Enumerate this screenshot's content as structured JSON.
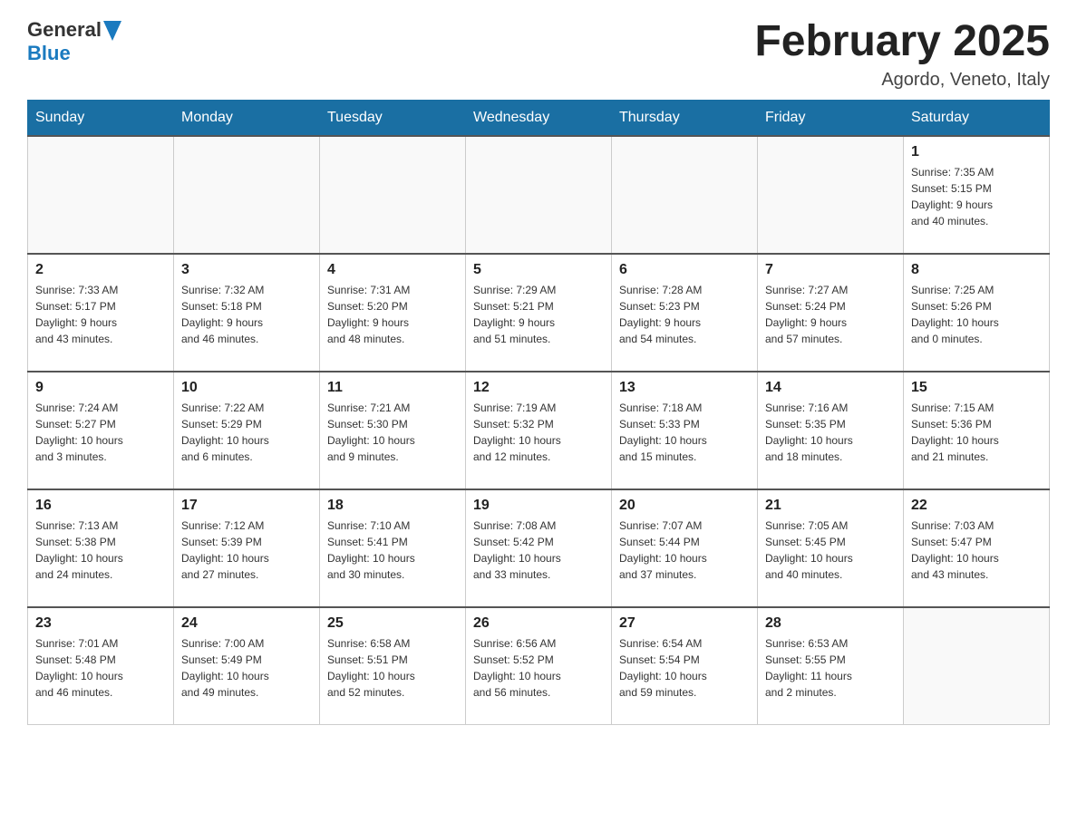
{
  "header": {
    "logo": {
      "general": "General",
      "arrow": "▶",
      "blue": "Blue"
    },
    "title": "February 2025",
    "location": "Agordo, Veneto, Italy"
  },
  "weekdays": [
    "Sunday",
    "Monday",
    "Tuesday",
    "Wednesday",
    "Thursday",
    "Friday",
    "Saturday"
  ],
  "weeks": [
    {
      "days": [
        {
          "number": "",
          "info": ""
        },
        {
          "number": "",
          "info": ""
        },
        {
          "number": "",
          "info": ""
        },
        {
          "number": "",
          "info": ""
        },
        {
          "number": "",
          "info": ""
        },
        {
          "number": "",
          "info": ""
        },
        {
          "number": "1",
          "info": "Sunrise: 7:35 AM\nSunset: 5:15 PM\nDaylight: 9 hours\nand 40 minutes."
        }
      ]
    },
    {
      "days": [
        {
          "number": "2",
          "info": "Sunrise: 7:33 AM\nSunset: 5:17 PM\nDaylight: 9 hours\nand 43 minutes."
        },
        {
          "number": "3",
          "info": "Sunrise: 7:32 AM\nSunset: 5:18 PM\nDaylight: 9 hours\nand 46 minutes."
        },
        {
          "number": "4",
          "info": "Sunrise: 7:31 AM\nSunset: 5:20 PM\nDaylight: 9 hours\nand 48 minutes."
        },
        {
          "number": "5",
          "info": "Sunrise: 7:29 AM\nSunset: 5:21 PM\nDaylight: 9 hours\nand 51 minutes."
        },
        {
          "number": "6",
          "info": "Sunrise: 7:28 AM\nSunset: 5:23 PM\nDaylight: 9 hours\nand 54 minutes."
        },
        {
          "number": "7",
          "info": "Sunrise: 7:27 AM\nSunset: 5:24 PM\nDaylight: 9 hours\nand 57 minutes."
        },
        {
          "number": "8",
          "info": "Sunrise: 7:25 AM\nSunset: 5:26 PM\nDaylight: 10 hours\nand 0 minutes."
        }
      ]
    },
    {
      "days": [
        {
          "number": "9",
          "info": "Sunrise: 7:24 AM\nSunset: 5:27 PM\nDaylight: 10 hours\nand 3 minutes."
        },
        {
          "number": "10",
          "info": "Sunrise: 7:22 AM\nSunset: 5:29 PM\nDaylight: 10 hours\nand 6 minutes."
        },
        {
          "number": "11",
          "info": "Sunrise: 7:21 AM\nSunset: 5:30 PM\nDaylight: 10 hours\nand 9 minutes."
        },
        {
          "number": "12",
          "info": "Sunrise: 7:19 AM\nSunset: 5:32 PM\nDaylight: 10 hours\nand 12 minutes."
        },
        {
          "number": "13",
          "info": "Sunrise: 7:18 AM\nSunset: 5:33 PM\nDaylight: 10 hours\nand 15 minutes."
        },
        {
          "number": "14",
          "info": "Sunrise: 7:16 AM\nSunset: 5:35 PM\nDaylight: 10 hours\nand 18 minutes."
        },
        {
          "number": "15",
          "info": "Sunrise: 7:15 AM\nSunset: 5:36 PM\nDaylight: 10 hours\nand 21 minutes."
        }
      ]
    },
    {
      "days": [
        {
          "number": "16",
          "info": "Sunrise: 7:13 AM\nSunset: 5:38 PM\nDaylight: 10 hours\nand 24 minutes."
        },
        {
          "number": "17",
          "info": "Sunrise: 7:12 AM\nSunset: 5:39 PM\nDaylight: 10 hours\nand 27 minutes."
        },
        {
          "number": "18",
          "info": "Sunrise: 7:10 AM\nSunset: 5:41 PM\nDaylight: 10 hours\nand 30 minutes."
        },
        {
          "number": "19",
          "info": "Sunrise: 7:08 AM\nSunset: 5:42 PM\nDaylight: 10 hours\nand 33 minutes."
        },
        {
          "number": "20",
          "info": "Sunrise: 7:07 AM\nSunset: 5:44 PM\nDaylight: 10 hours\nand 37 minutes."
        },
        {
          "number": "21",
          "info": "Sunrise: 7:05 AM\nSunset: 5:45 PM\nDaylight: 10 hours\nand 40 minutes."
        },
        {
          "number": "22",
          "info": "Sunrise: 7:03 AM\nSunset: 5:47 PM\nDaylight: 10 hours\nand 43 minutes."
        }
      ]
    },
    {
      "days": [
        {
          "number": "23",
          "info": "Sunrise: 7:01 AM\nSunset: 5:48 PM\nDaylight: 10 hours\nand 46 minutes."
        },
        {
          "number": "24",
          "info": "Sunrise: 7:00 AM\nSunset: 5:49 PM\nDaylight: 10 hours\nand 49 minutes."
        },
        {
          "number": "25",
          "info": "Sunrise: 6:58 AM\nSunset: 5:51 PM\nDaylight: 10 hours\nand 52 minutes."
        },
        {
          "number": "26",
          "info": "Sunrise: 6:56 AM\nSunset: 5:52 PM\nDaylight: 10 hours\nand 56 minutes."
        },
        {
          "number": "27",
          "info": "Sunrise: 6:54 AM\nSunset: 5:54 PM\nDaylight: 10 hours\nand 59 minutes."
        },
        {
          "number": "28",
          "info": "Sunrise: 6:53 AM\nSunset: 5:55 PM\nDaylight: 11 hours\nand 2 minutes."
        },
        {
          "number": "",
          "info": ""
        }
      ]
    }
  ]
}
